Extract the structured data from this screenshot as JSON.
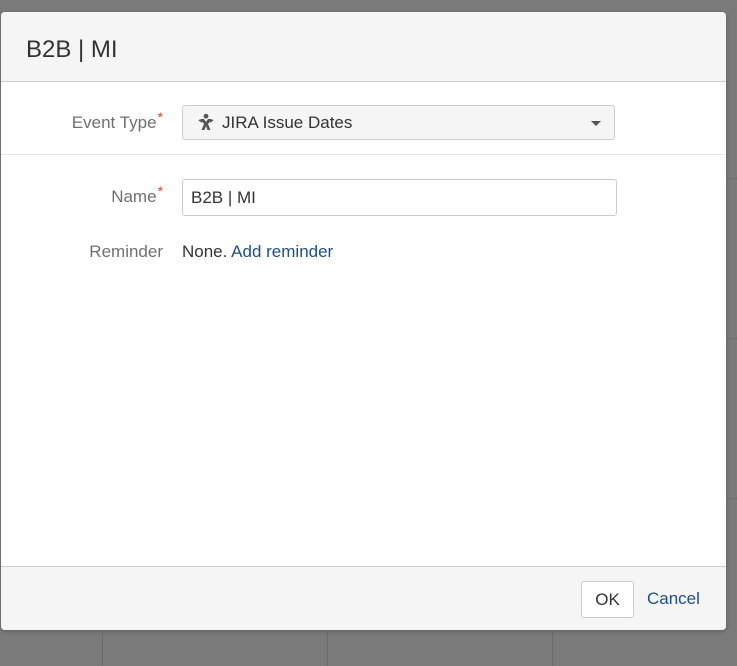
{
  "dialog": {
    "title": "B2B | MI",
    "event_type": {
      "label": "Event Type",
      "required_mark": "*",
      "selected": "JIRA Issue Dates",
      "icon": "jira-icon"
    },
    "name": {
      "label": "Name",
      "required_mark": "*",
      "value": "B2B | MI"
    },
    "reminder": {
      "label": "Reminder",
      "value_text": "None.",
      "link_text": "Add reminder"
    },
    "footer": {
      "ok_label": "OK",
      "cancel_label": "Cancel"
    }
  },
  "colors": {
    "link": "#205081",
    "required": "#d04437",
    "overlay": "#7a7a7a"
  }
}
